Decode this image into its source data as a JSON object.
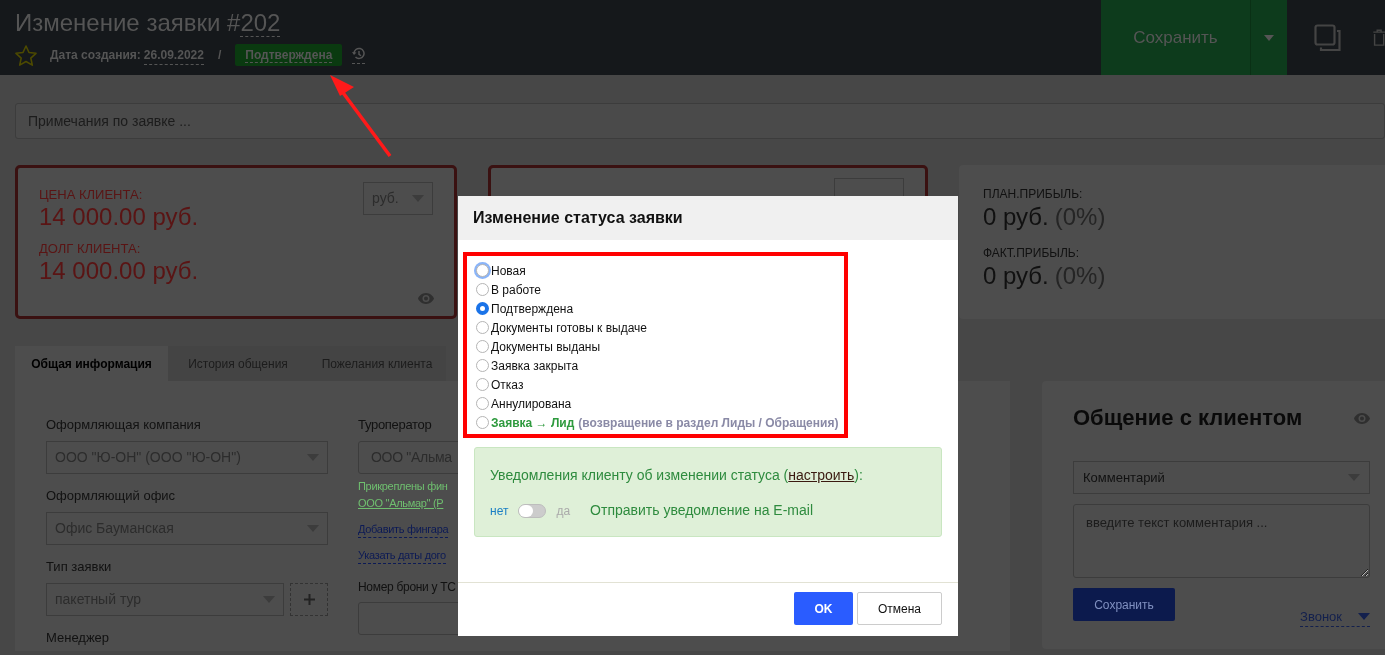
{
  "header": {
    "favorite": false,
    "title": "Изменение заявки #",
    "number": "202",
    "created_label": "Дата создания:",
    "created_date": "26.09.2022",
    "separator": "/",
    "status": "Подтверждена",
    "save_button": "Сохранить"
  },
  "notes": {
    "placeholder": "Примечания по заявке ..."
  },
  "client_card": {
    "price_label": "ЦЕНА КЛИЕНТА:",
    "price": "14 000.00 руб.",
    "debt_label": "ДОЛГ КЛИЕНТА:",
    "debt": "14 000.00 руб.",
    "currency": "руб."
  },
  "profit_card": {
    "items": [
      {
        "label": "ПЛАН.ПРИБЫЛЬ:",
        "value": "0 руб.",
        "percent": "(0%)"
      },
      {
        "label": "ФАКТ.ПРИБЫЛЬ:",
        "value": "0 руб.",
        "percent": "(0%)"
      }
    ]
  },
  "tabs": [
    {
      "label": "Общая информация",
      "selected": true
    },
    {
      "label": "История общения",
      "selected": false
    },
    {
      "label": "Пожелания клиента",
      "selected": false
    }
  ],
  "form": {
    "left": [
      {
        "kind": "select",
        "label": "Оформляющая компания",
        "value": "ООО \"Ю-ОН\" (ООО \"Ю-ОН\")"
      },
      {
        "kind": "select",
        "label": "Оформляющий офис",
        "value": "Офис Бауманская"
      },
      {
        "kind": "select_add",
        "label": "Тип заявки",
        "value": "пакетный тур"
      },
      {
        "kind": "label",
        "label": "Менеджер"
      }
    ],
    "right": {
      "operator_label": "Туроператор",
      "operator_value": "ООО \"Альма",
      "finance_note": "Прикреплены фин",
      "finance_link": "ООО \"Альмар\" (Р",
      "add_link": "Добавить фингара",
      "dates_link": "Указать даты дого",
      "booking_label": "Номер брони у ТС"
    }
  },
  "chat": {
    "title": "Общение с клиентом",
    "type": "Комментарий",
    "placeholder": "введите текст комментария ...",
    "save_button": "Сохранить",
    "call_link": "Звонок"
  },
  "modal": {
    "title": "Изменение статуса заявки",
    "options": [
      {
        "kind": "plain",
        "label": "Новая",
        "selected": false,
        "focused": true
      },
      {
        "kind": "plain",
        "label": "В работе",
        "selected": false,
        "focused": false
      },
      {
        "kind": "plain",
        "label": "Подтверждена",
        "selected": true,
        "focused": false
      },
      {
        "kind": "plain",
        "label": "Документы готовы к выдаче",
        "selected": false,
        "focused": false
      },
      {
        "kind": "plain",
        "label": "Документы выданы",
        "selected": false,
        "focused": false
      },
      {
        "kind": "plain",
        "label": "Заявка закрыта",
        "selected": false,
        "focused": false
      },
      {
        "kind": "plain",
        "label": "Отказ",
        "selected": false,
        "focused": false
      },
      {
        "kind": "plain",
        "label": "Аннулирована",
        "selected": false,
        "focused": false
      },
      {
        "kind": "lead",
        "label": "Заявка → Лид",
        "note": "(возвращение в раздел Лиды / Обращения)",
        "selected": false,
        "focused": false
      }
    ],
    "notification": {
      "text_before": "Уведомления клиенту об изменении статуса (",
      "link": "настроить",
      "text_after": "):",
      "off_label": "нет",
      "on_label": "да",
      "on": false,
      "action": "Отправить уведомление на E-mail"
    },
    "ok_button": "OK",
    "cancel_button": "Отмена"
  }
}
